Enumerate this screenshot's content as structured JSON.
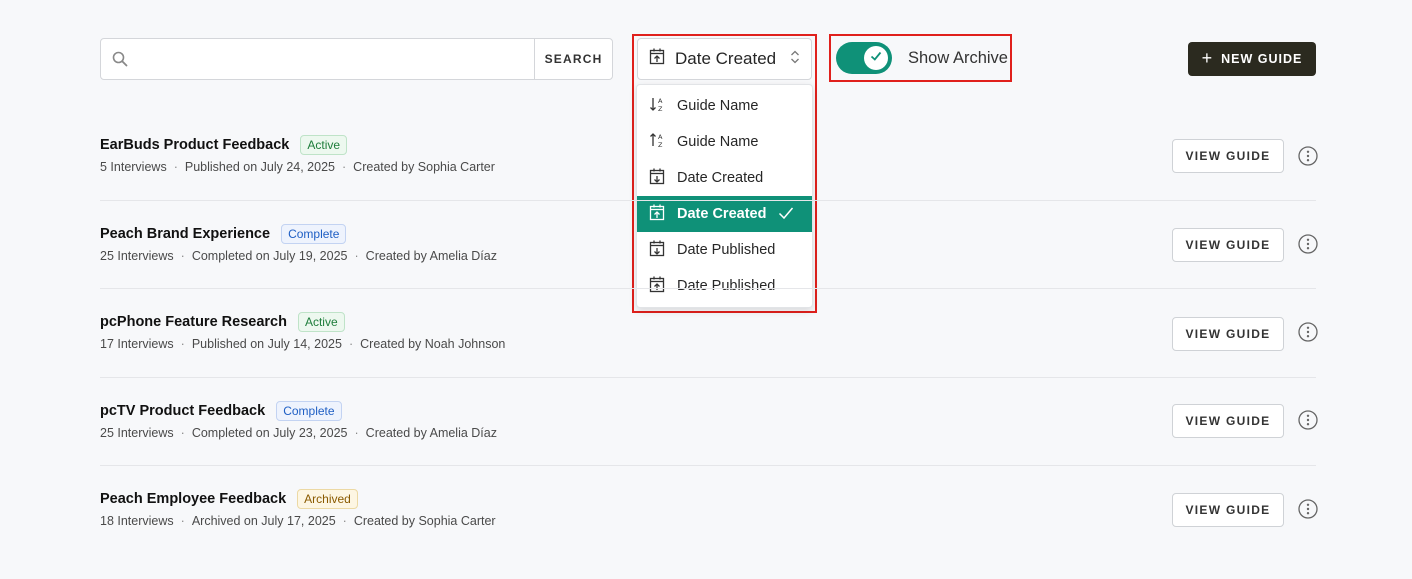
{
  "search": {
    "placeholder": "",
    "value": "",
    "button_label": "SEARCH"
  },
  "sort": {
    "selected_label": "Date Created",
    "options": [
      {
        "label": "Guide Name",
        "icon": "sort-alpha-down-icon",
        "selected": false
      },
      {
        "label": "Guide Name",
        "icon": "sort-alpha-up-icon",
        "selected": false
      },
      {
        "label": "Date Created",
        "icon": "calendar-arrow-down-icon",
        "selected": false
      },
      {
        "label": "Date Created",
        "icon": "calendar-arrow-up-icon",
        "selected": true
      },
      {
        "label": "Date Published",
        "icon": "calendar-arrow-down-icon",
        "selected": false
      },
      {
        "label": "Date Published",
        "icon": "calendar-arrow-up-icon",
        "selected": false
      }
    ]
  },
  "archive_toggle": {
    "label": "Show Archive",
    "on": true
  },
  "new_guide": {
    "label": "NEW GUIDE"
  },
  "colors": {
    "accent": "#0f9178",
    "primary_dark": "#2b2a1f",
    "highlight": "#e0201c"
  },
  "guides": [
    {
      "title": "EarBuds Product Feedback",
      "status": "Active",
      "status_type": "active",
      "interviews": "5 Interviews",
      "date": "Published on July 24, 2025",
      "creator": "Created by Sophia Carter",
      "action": "VIEW GUIDE"
    },
    {
      "title": "Peach Brand Experience",
      "status": "Complete",
      "status_type": "complete",
      "interviews": "25 Interviews",
      "date": "Completed on July 19, 2025",
      "creator": "Created by Amelia Díaz",
      "action": "VIEW GUIDE"
    },
    {
      "title": "pcPhone Feature Research",
      "status": "Active",
      "status_type": "active",
      "interviews": "17 Interviews",
      "date": "Published on July 14, 2025",
      "creator": "Created by Noah Johnson",
      "action": "VIEW GUIDE"
    },
    {
      "title": "pcTV Product Feedback",
      "status": "Complete",
      "status_type": "complete",
      "interviews": "25 Interviews",
      "date": "Completed on July 23, 2025",
      "creator": "Created by Amelia Díaz",
      "action": "VIEW GUIDE"
    },
    {
      "title": "Peach Employee Feedback",
      "status": "Archived",
      "status_type": "archived",
      "interviews": "18 Interviews",
      "date": "Archived on July 17, 2025",
      "creator": "Created by Sophia Carter",
      "action": "VIEW GUIDE"
    }
  ]
}
